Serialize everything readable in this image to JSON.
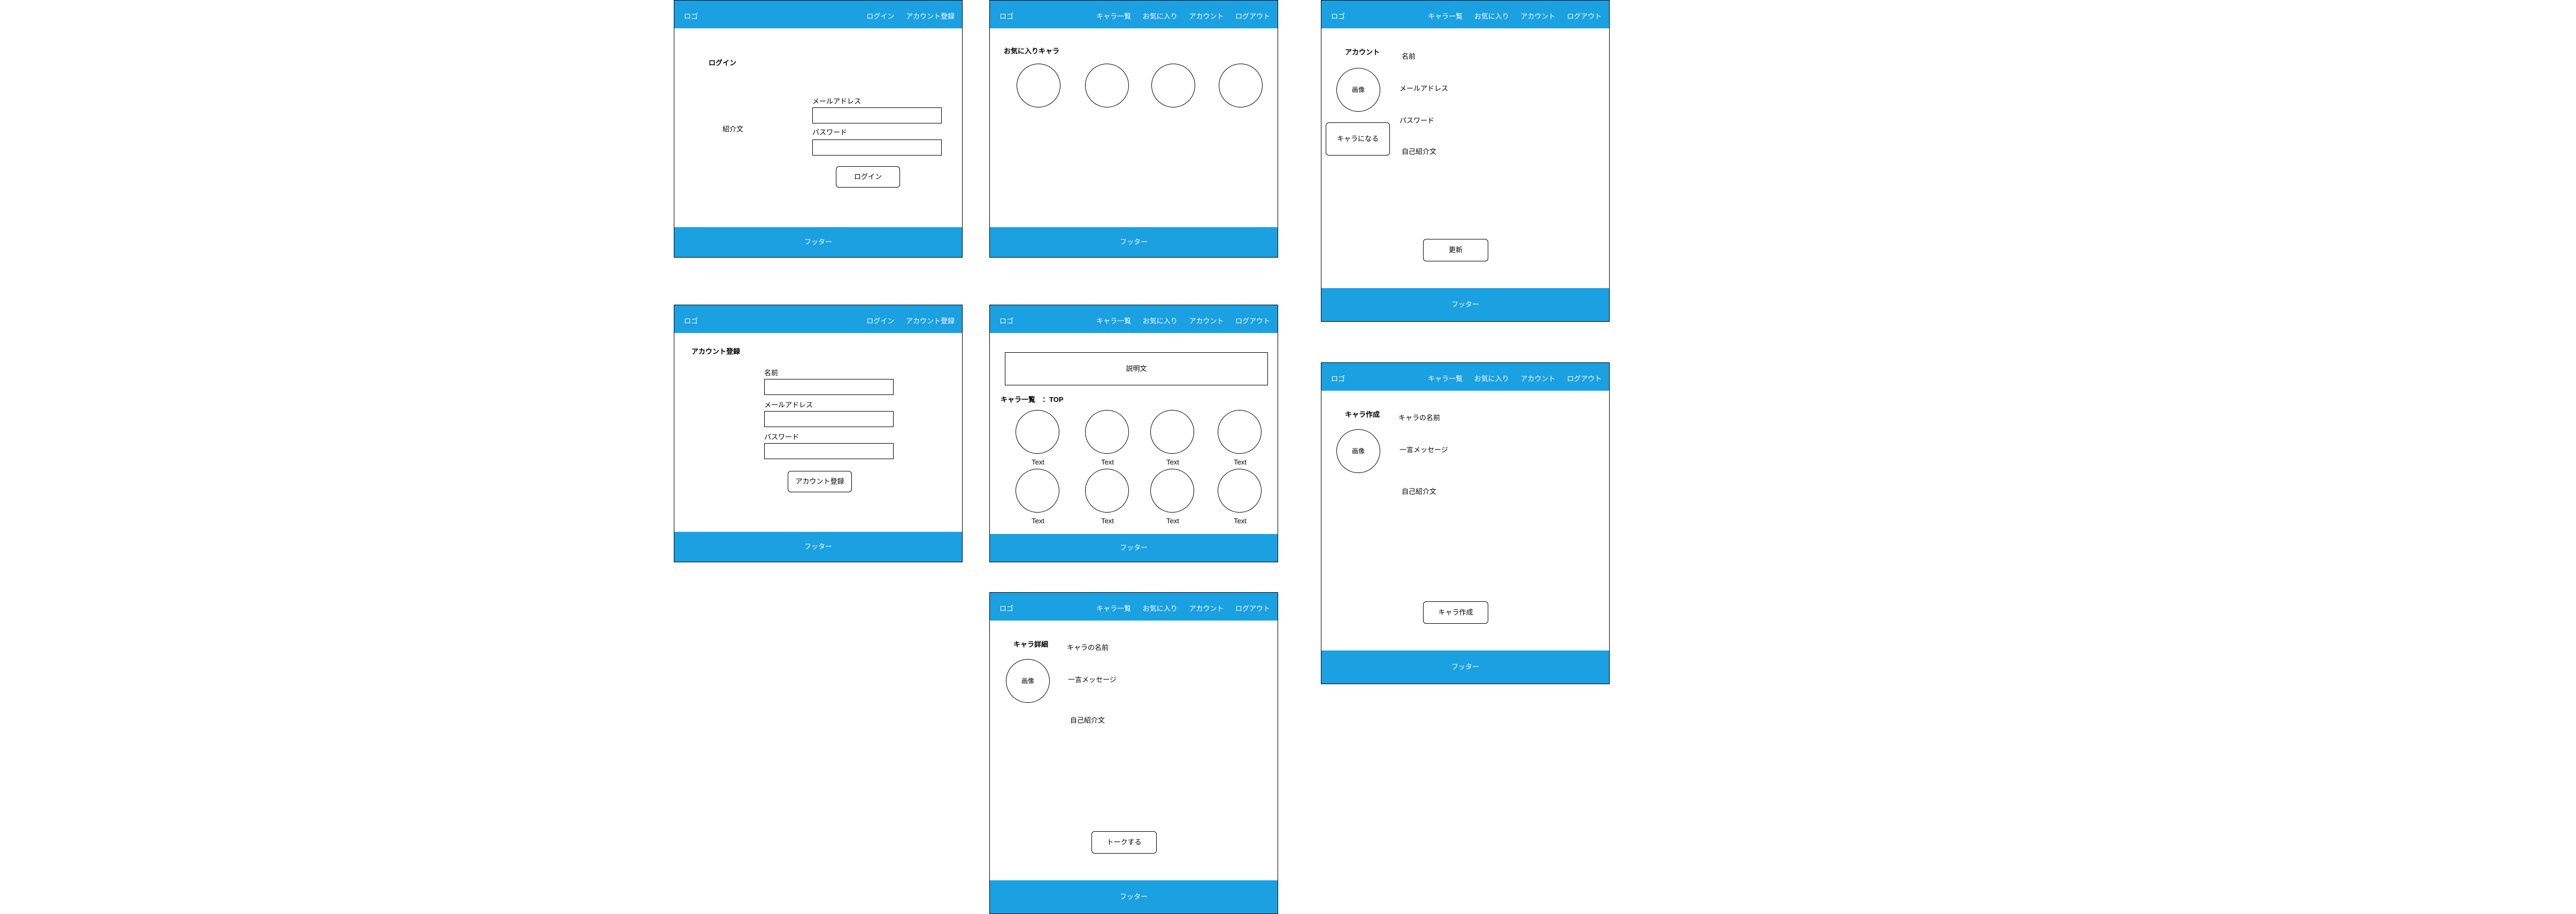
{
  "header": {
    "logo": "ロゴ",
    "guest_nav": [
      "ログイン",
      "アカウント登録"
    ],
    "user_nav": [
      "キャラ一覧",
      "お気に入り",
      "アカウント",
      "ログアウト"
    ]
  },
  "footer": "フッター",
  "login": {
    "title": "ログイン",
    "intro": "紹介文",
    "email_label": "メールアドレス",
    "password_label": "パスワード",
    "button": "ログイン"
  },
  "register": {
    "title": "アカウント登録",
    "name_label": "名前",
    "email_label": "メールアドレス",
    "password_label": "パスワード",
    "button": "アカウント登録"
  },
  "favorites": {
    "title": "お気に入りキャラ"
  },
  "char_list": {
    "description": "説明文",
    "title": "キャラ一覧　：TOP",
    "captions": [
      "Text",
      "Text",
      "Text",
      "Text",
      "Text",
      "Text",
      "Text",
      "Text"
    ]
  },
  "char_detail": {
    "title": "キャラ詳細",
    "image": "画像",
    "name": "キャラの名前",
    "message": "一言メッセージ",
    "bio": "自己紹介文",
    "button": "トークする"
  },
  "account": {
    "title": "アカウント",
    "image": "画像",
    "name": "名前",
    "email": "メールアドレス",
    "password": "パスワード",
    "bio": "自己紹介文",
    "become_button": "キャラになる",
    "update_button": "更新"
  },
  "char_create": {
    "title": "キャラ作成",
    "image": "画像",
    "name": "キャラの名前",
    "message": "一言メッセージ",
    "bio": "自己紹介文",
    "button": "キャラ作成"
  }
}
